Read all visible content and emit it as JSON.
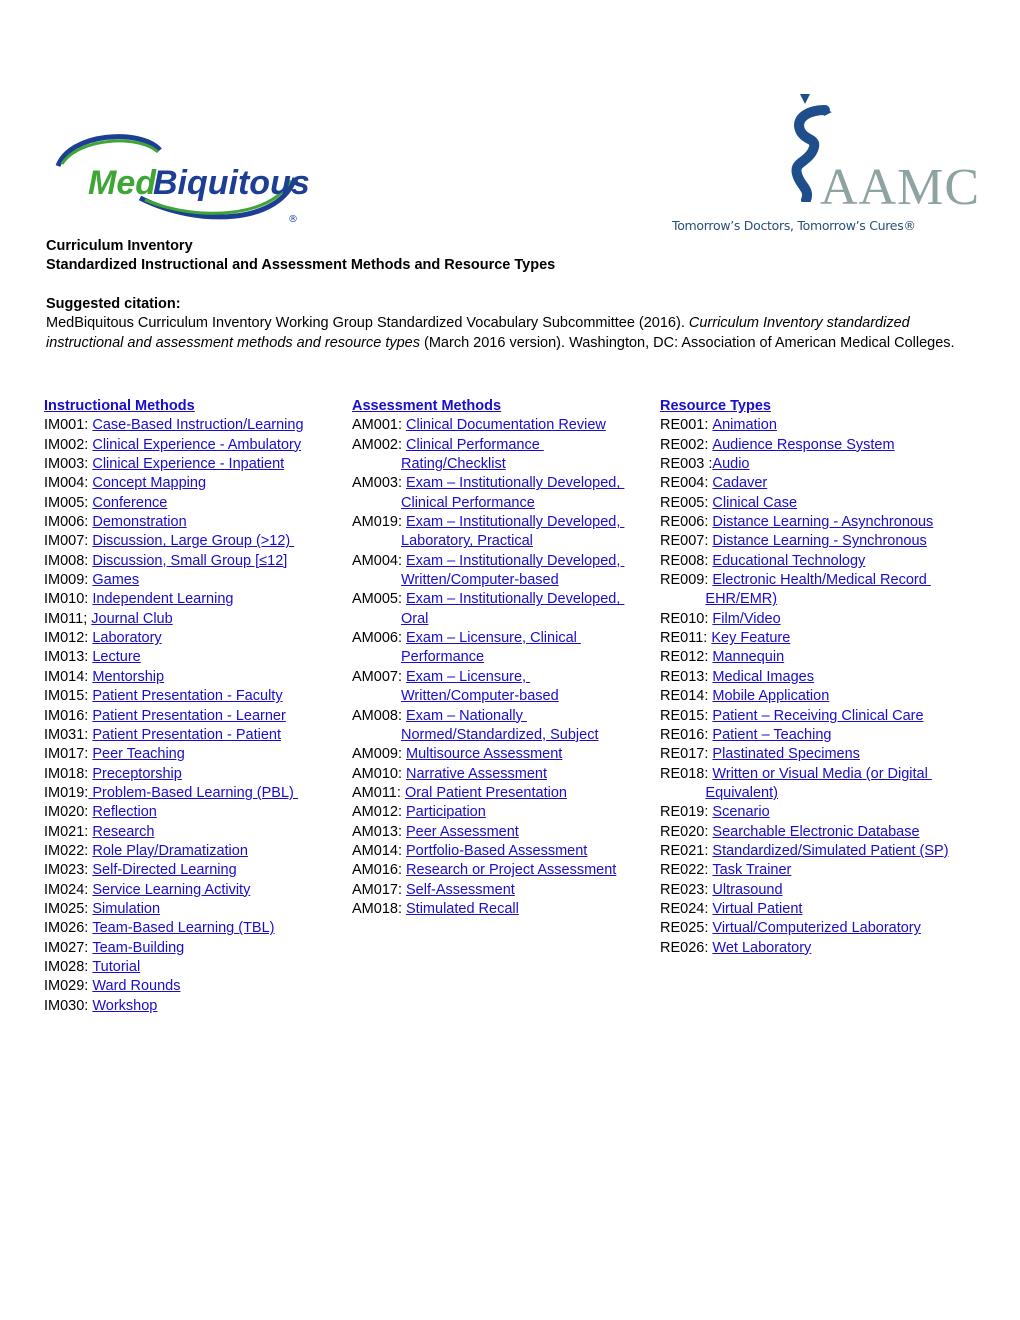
{
  "logos": {
    "left": {
      "name": "MedBiquitous",
      "part1": "Med",
      "part2": "Biquitous",
      "trademark": "®",
      "green": "#3fa535",
      "blue": "#1c3f94"
    },
    "right": {
      "name": "AAMC",
      "tagline": "Tomorrow’s Doctors, Tomorrow’s Cures®",
      "staff_color": "#1f4e8c",
      "text_color": "#8fa3a3"
    }
  },
  "header": {
    "title_line1": "Curriculum Inventory",
    "title_line2": "Standardized Instructional and Assessment Methods and Resource Types"
  },
  "citation": {
    "label": "Suggested citation:",
    "part1": "MedBiquitous Curriculum Inventory Working Group Standardized Vocabulary Subcommittee (2016). ",
    "italic": "Curriculum Inventory standardized instructional and assessment methods and resource types",
    "part2": " (March 2016 version). Washington, DC: Association of American Medical Colleges."
  },
  "link_color": "#1a0dcc",
  "instructional_methods": {
    "heading": "Instructional Methods",
    "items": [
      {
        "code": "IM001: ",
        "label": "Case-Based Instruction/Learning"
      },
      {
        "code": "IM002: ",
        "label": "Clinical Experience - Ambulatory"
      },
      {
        "code": "IM003: ",
        "label": "Clinical Experience - Inpatient"
      },
      {
        "code": "IM004: ",
        "label": "Concept Mapping"
      },
      {
        "code": "IM005: ",
        "label": "Conference"
      },
      {
        "code": "IM006: ",
        "label": "Demonstration"
      },
      {
        "code": "IM007: ",
        "label": "Discussion, Large Group (>12) "
      },
      {
        "code": "IM008: ",
        "label": "Discussion, Small Group [≤12]"
      },
      {
        "code": "IM009: ",
        "label": "Games"
      },
      {
        "code": "IM010: ",
        "label": "Independent Learning"
      },
      {
        "code": "IM011; ",
        "label": "Journal Club"
      },
      {
        "code": "IM012: ",
        "label": "Laboratory"
      },
      {
        "code": "IM013: ",
        "label": "Lecture"
      },
      {
        "code": "IM014: ",
        "label": "Mentorship"
      },
      {
        "code": "IM015: ",
        "label": "Patient Presentation - Faculty"
      },
      {
        "code": "IM016: ",
        "label": "Patient Presentation - Learner"
      },
      {
        "code": "IM031: ",
        "label": "Patient Presentation - Patient"
      },
      {
        "code": "IM017: ",
        "label": "Peer Teaching"
      },
      {
        "code": "IM018: ",
        "label": "Preceptorship"
      },
      {
        "code": "IM019:",
        "label": " Problem-Based Learning (PBL) "
      },
      {
        "code": "IM020: ",
        "label": "Reflection"
      },
      {
        "code": "IM021: ",
        "label": "Research"
      },
      {
        "code": "IM022: ",
        "label": "Role Play/Dramatization"
      },
      {
        "code": "IM023: ",
        "label": "Self-Directed Learning"
      },
      {
        "code": "IM024: ",
        "label": "Service Learning Activity"
      },
      {
        "code": "IM025: ",
        "label": "Simulation"
      },
      {
        "code": "IM026: ",
        "label": "Team-Based Learning (TBL)"
      },
      {
        "code": "IM027: ",
        "label": "Team-Building"
      },
      {
        "code": "IM028: ",
        "label": "Tutorial"
      },
      {
        "code": "IM029: ",
        "label": "Ward Rounds"
      },
      {
        "code": "IM030: ",
        "label": "Workshop"
      }
    ]
  },
  "assessment_methods": {
    "heading": "Assessment Methods",
    "items": [
      {
        "code": "AM001: ",
        "label": "Clinical Documentation Review",
        "label2": ""
      },
      {
        "code": "AM002: ",
        "label": "Clinical Performance ",
        "label2": "Rating/Checklist"
      },
      {
        "code": "AM003: ",
        "label": "Exam – Institutionally Developed, ",
        "label2": "Clinical Performance"
      },
      {
        "code": "AM019: ",
        "label": "Exam – Institutionally Developed, ",
        "label2": "Laboratory, Practical"
      },
      {
        "code": "AM004: ",
        "label": "Exam – Institutionally Developed, ",
        "label2": "Written/Computer-based"
      },
      {
        "code": "AM005: ",
        "label": "Exam – Institutionally Developed, ",
        "label2": "Oral"
      },
      {
        "code": "AM006: ",
        "label": "Exam – Licensure, Clinical ",
        "label2": "Performance"
      },
      {
        "code": "AM007: ",
        "label": "Exam – Licensure, ",
        "label2": "Written/Computer-based"
      },
      {
        "code": "AM008: ",
        "label": "Exam – Nationally ",
        "label2": "Normed/Standardized, Subject"
      },
      {
        "code": "AM009: ",
        "label": "Multisource Assessment",
        "label2": ""
      },
      {
        "code": "AM010: ",
        "label": "Narrative Assessment",
        "label2": ""
      },
      {
        "code": "AM011: ",
        "label": "Oral Patient Presentation",
        "label2": ""
      },
      {
        "code": "AM012: ",
        "label": "Participation",
        "label2": ""
      },
      {
        "code": "AM013: ",
        "label": "Peer Assessment",
        "label2": ""
      },
      {
        "code": "AM014: ",
        "label": "Portfolio-Based Assessment",
        "label2": ""
      },
      {
        "code": "AM016: ",
        "label": "Research or Project Assessment",
        "label2": ""
      },
      {
        "code": "AM017: ",
        "label": "Self-Assessment",
        "label2": ""
      },
      {
        "code": "AM018: ",
        "label": "Stimulated Recall",
        "label2": ""
      }
    ]
  },
  "resource_types": {
    "heading": "Resource Types",
    "items": [
      {
        "code": "RE001: ",
        "label": "Animation",
        "label2": ""
      },
      {
        "code": "RE002: ",
        "label": "Audience Response System",
        "label2": ""
      },
      {
        "code": "RE003 :",
        "label": "Audio",
        "label2": ""
      },
      {
        "code": "RE004: ",
        "label": "Cadaver",
        "label2": ""
      },
      {
        "code": "RE005: ",
        "label": "Clinical Case",
        "label2": ""
      },
      {
        "code": "RE006: ",
        "label": "Distance Learning - Asynchronous",
        "label2": ""
      },
      {
        "code": "RE007: ",
        "label": "Distance Learning - Synchronous",
        "label2": ""
      },
      {
        "code": "RE008: ",
        "label": "Educational Technology",
        "label2": ""
      },
      {
        "code": "RE009: ",
        "label": "Electronic Health/Medical Record ",
        "label2": "EHR/EMR)"
      },
      {
        "code": "RE010: ",
        "label": "Film/Video",
        "label2": ""
      },
      {
        "code": "RE011: ",
        "label": "Key Feature",
        "label2": ""
      },
      {
        "code": "RE012: ",
        "label": "Mannequin",
        "label2": ""
      },
      {
        "code": "RE013: ",
        "label": "Medical Images",
        "label2": ""
      },
      {
        "code": "RE014: ",
        "label": "Mobile Application",
        "label2": ""
      },
      {
        "code": "RE015: ",
        "label": "Patient – Receiving Clinical Care",
        "label2": ""
      },
      {
        "code": "RE016: ",
        "label": "Patient – Teaching",
        "label2": ""
      },
      {
        "code": "RE017: ",
        "label": "Plastinated Specimens",
        "label2": ""
      },
      {
        "code": "RE018: ",
        "label": "Written or Visual Media (or Digital ",
        "label2": "Equivalent)"
      },
      {
        "code": "RE019: ",
        "label": "Scenario",
        "label2": ""
      },
      {
        "code": "RE020: ",
        "label": "Searchable Electronic Database",
        "label2": ""
      },
      {
        "code": "RE021: ",
        "label": "Standardized/Simulated Patient (SP)",
        "label2": ""
      },
      {
        "code": "RE022: ",
        "label": "Task Trainer",
        "label2": ""
      },
      {
        "code": "RE023: ",
        "label": "Ultrasound",
        "label2": ""
      },
      {
        "code": "RE024: ",
        "label": "Virtual Patient",
        "label2": ""
      },
      {
        "code": "RE025: ",
        "label": "Virtual/Computerized Laboratory",
        "label2": ""
      },
      {
        "code": "RE026: ",
        "label": "Wet Laboratory",
        "label2": ""
      }
    ]
  }
}
